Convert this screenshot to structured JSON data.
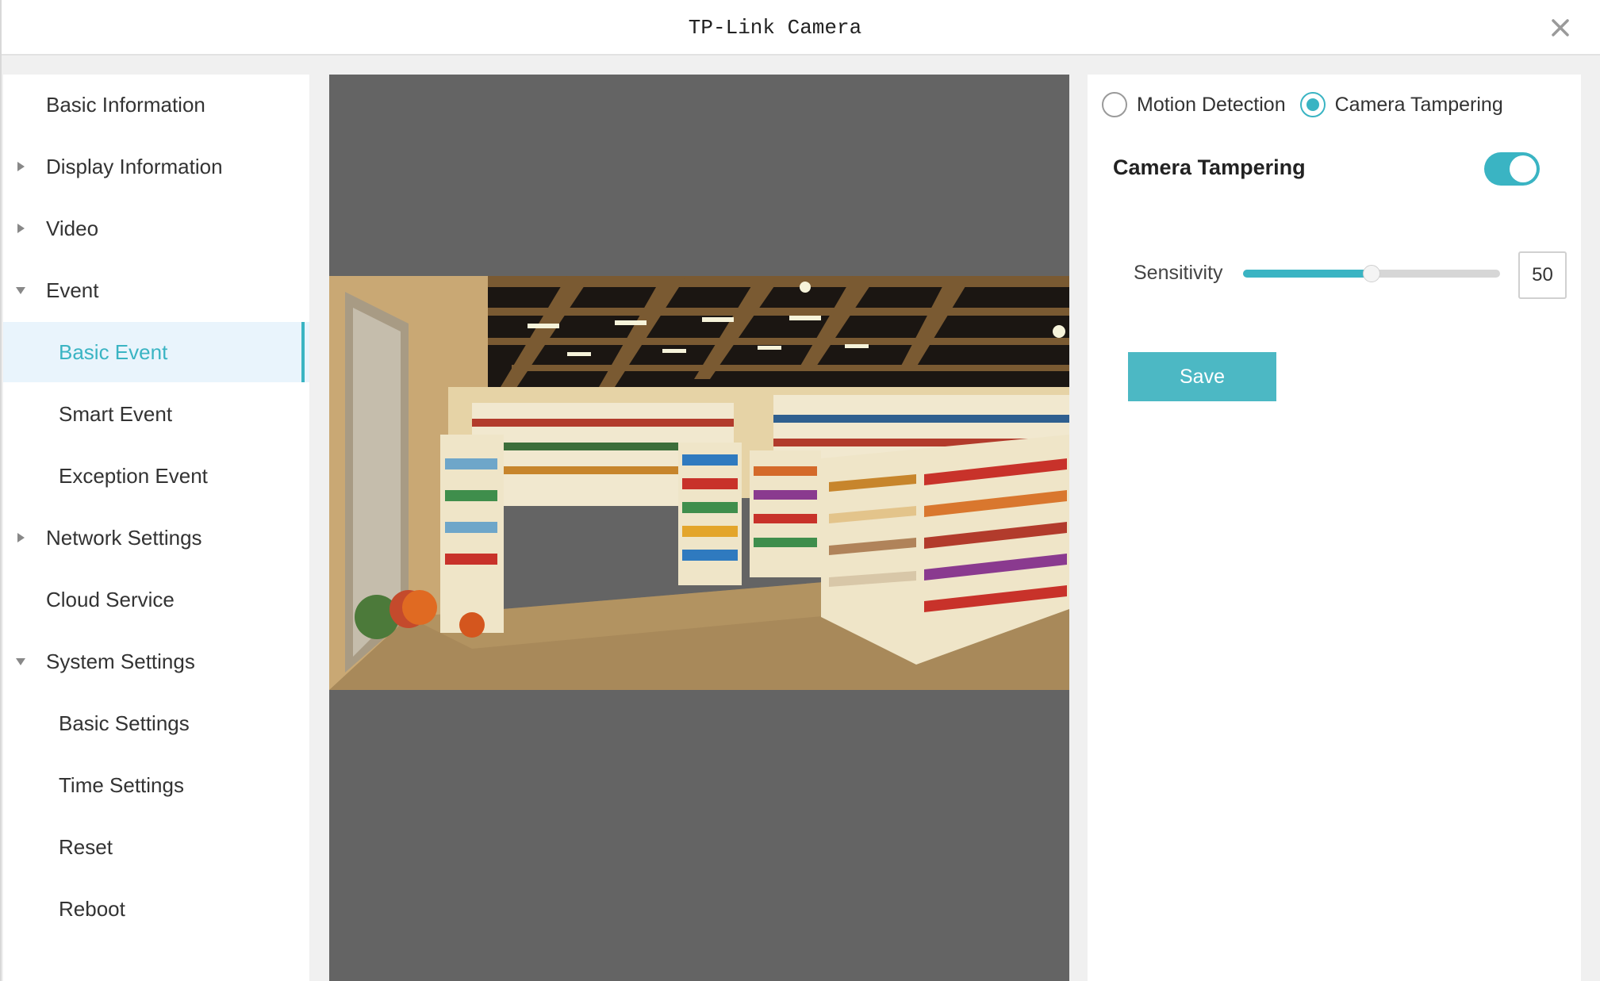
{
  "window": {
    "title": "TP-Link Camera",
    "close_icon": "close-icon"
  },
  "sidebar": {
    "items": [
      {
        "label": "Basic Information",
        "arrow": "none",
        "sub": false
      },
      {
        "label": "Display Information",
        "arrow": "right",
        "sub": false
      },
      {
        "label": "Video",
        "arrow": "right",
        "sub": false
      },
      {
        "label": "Event",
        "arrow": "down",
        "sub": false
      },
      {
        "label": "Basic Event",
        "arrow": "none",
        "sub": true,
        "active": true
      },
      {
        "label": "Smart Event",
        "arrow": "none",
        "sub": true
      },
      {
        "label": "Exception Event",
        "arrow": "none",
        "sub": true
      },
      {
        "label": "Network Settings",
        "arrow": "right",
        "sub": false
      },
      {
        "label": "Cloud Service",
        "arrow": "none",
        "sub": false
      },
      {
        "label": "System Settings",
        "arrow": "down",
        "sub": false
      },
      {
        "label": "Basic Settings",
        "arrow": "none",
        "sub": true
      },
      {
        "label": "Time Settings",
        "arrow": "none",
        "sub": true
      },
      {
        "label": "Reset",
        "arrow": "none",
        "sub": true
      },
      {
        "label": "Reboot",
        "arrow": "none",
        "sub": true
      }
    ]
  },
  "panel": {
    "radio_motion": "Motion Detection",
    "radio_tampering": "Camera Tampering",
    "selected_mode": "Camera Tampering",
    "section_title": "Camera Tampering",
    "toggle_on": true,
    "sensitivity_label": "Sensitivity",
    "sensitivity_value": "50",
    "sensitivity_fraction": 0.5,
    "save_label": "Save"
  },
  "colors": {
    "accent": "#3ab4c3",
    "video_bg": "#646464"
  }
}
